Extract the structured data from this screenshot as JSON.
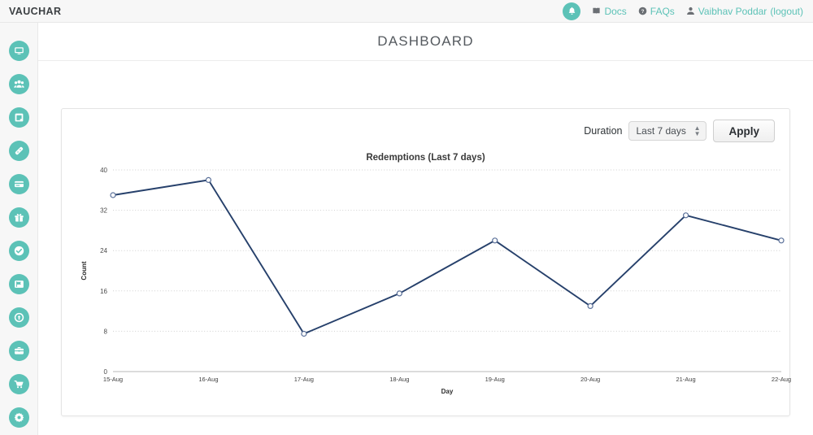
{
  "header": {
    "brand": "VAUCHAR",
    "bell_icon": "bell-icon",
    "links": [
      {
        "label": "Docs",
        "icon": "book-icon"
      },
      {
        "label": "FAQs",
        "icon": "question-circle-icon"
      }
    ],
    "user": {
      "icon": "user-icon",
      "name": "Vaibhav Poddar",
      "logout": "(logout)"
    }
  },
  "sidebar": {
    "items": [
      {
        "icon": "monitor-icon",
        "name": "dashboard"
      },
      {
        "icon": "users-icon",
        "name": "users"
      },
      {
        "icon": "notes-icon",
        "name": "notes"
      },
      {
        "icon": "tag-icon",
        "name": "coupons"
      },
      {
        "icon": "card-icon",
        "name": "cards"
      },
      {
        "icon": "gift-icon",
        "name": "gifts"
      },
      {
        "icon": "check-circle-icon",
        "name": "redemptions"
      },
      {
        "icon": "flag-icon",
        "name": "campaigns"
      },
      {
        "icon": "upload-circle-icon",
        "name": "uploads"
      },
      {
        "icon": "briefcase-icon",
        "name": "business"
      },
      {
        "icon": "cart-icon",
        "name": "orders"
      },
      {
        "icon": "gear-icon",
        "name": "settings"
      }
    ]
  },
  "page": {
    "title": "DASHBOARD"
  },
  "controls": {
    "duration_label": "Duration",
    "duration_value": "Last 7 days",
    "duration_options": [
      "Last 7 days"
    ],
    "apply_label": "Apply"
  },
  "colors": {
    "accent": "#5cc2b7",
    "line": "#26406b",
    "topbar_bg": "#f7f7f7",
    "card_border": "#e4e4e4"
  },
  "chart_data": {
    "type": "line",
    "title": "Redemptions (Last 7 days)",
    "xlabel": "Day",
    "ylabel": "Count",
    "categories": [
      "15-Aug",
      "16-Aug",
      "17-Aug",
      "18-Aug",
      "19-Aug",
      "20-Aug",
      "21-Aug",
      "22-Aug"
    ],
    "values": [
      35,
      38,
      7.5,
      15.5,
      26,
      13,
      31,
      26
    ],
    "yticks": [
      0,
      8,
      16,
      24,
      32,
      40
    ],
    "ylim": [
      0,
      40
    ],
    "grid": true,
    "legend": "none",
    "marker": "open-circle",
    "line_color": "#26406b"
  }
}
